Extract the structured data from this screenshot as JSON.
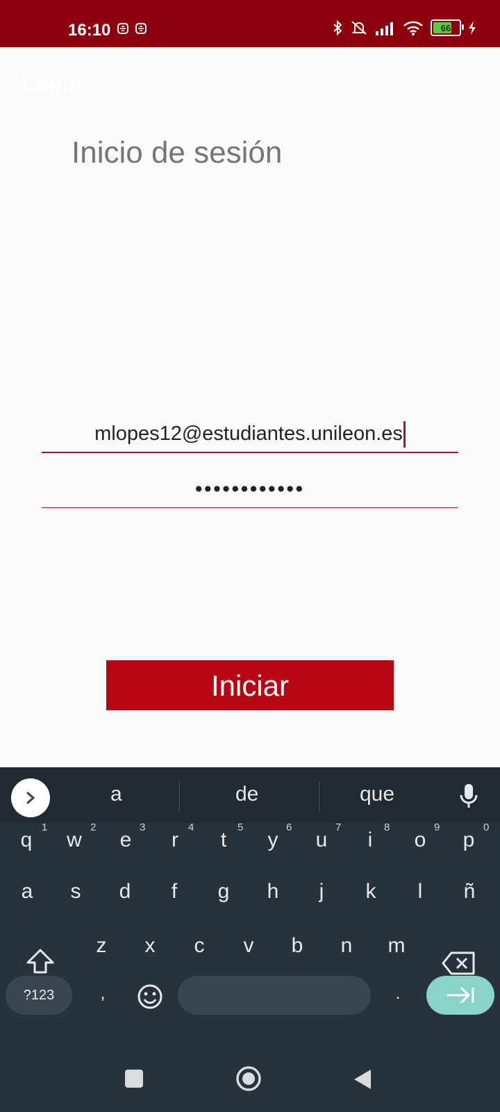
{
  "status_bar": {
    "time": "16:10",
    "battery_level": "66",
    "icons": [
      "notification-icon",
      "notification-icon",
      "bluetooth-icon",
      "silent-icon",
      "signal-icon",
      "wifi-icon",
      "battery-icon",
      "charging-icon"
    ]
  },
  "app": {
    "title": "Login",
    "heading": "Inicio de sesión"
  },
  "form": {
    "email_value": "mlopes12@estudiantes.unileon.es",
    "password_mask": "••••••••••••",
    "submit_label": "Iniciar"
  },
  "colors": {
    "status_bar": "#8b000c",
    "accent": "#b70513",
    "keyboard_bg": "#27323a",
    "action_key": "#8ad3c8"
  },
  "keyboard": {
    "suggestions": [
      "a",
      "de",
      "que"
    ],
    "row1": [
      "q",
      "w",
      "e",
      "r",
      "t",
      "y",
      "u",
      "i",
      "o",
      "p"
    ],
    "row1_hints": [
      "1",
      "2",
      "3",
      "4",
      "5",
      "6",
      "7",
      "8",
      "9",
      "0"
    ],
    "row2": [
      "a",
      "s",
      "d",
      "f",
      "g",
      "h",
      "j",
      "k",
      "l",
      "ñ"
    ],
    "row3": [
      "z",
      "x",
      "c",
      "v",
      "b",
      "n",
      "m"
    ],
    "symbols_label": "?123",
    "comma": ",",
    "period": "."
  }
}
